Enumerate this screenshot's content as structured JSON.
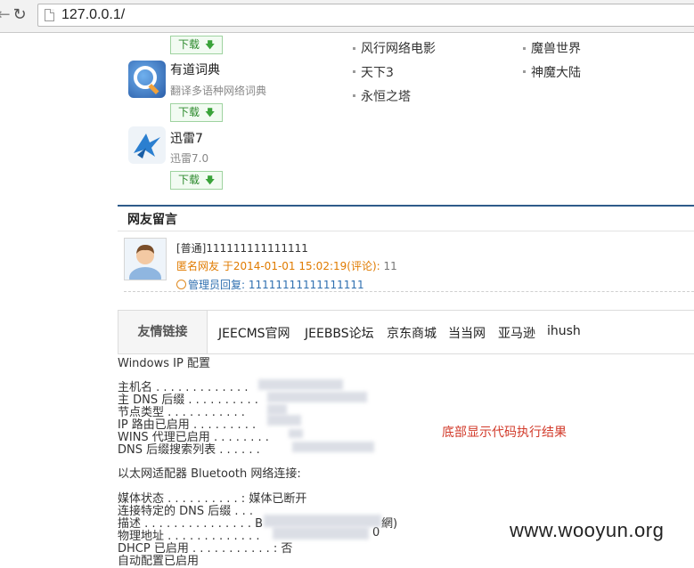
{
  "browser": {
    "url": "127.0.0.1/"
  },
  "downloads": {
    "button_label": "下载",
    "apps": [
      {
        "name": "有道词典",
        "desc": "翻译多语种网络词典",
        "icon": "youdao-dictionary-icon"
      },
      {
        "name": "迅雷7",
        "desc": "迅雷7.0",
        "icon": "thunder-bird-icon"
      }
    ]
  },
  "games": [
    "风行网络电影",
    "天下3",
    "永恒之塔",
    "魔兽世界",
    "神魔大陆"
  ],
  "comments": {
    "title": "网友留言",
    "items": [
      {
        "tag": "[普通]",
        "content": "111111111111111",
        "meta": "匿名网友 于2014-01-01 15:02:19(评论):",
        "count": "11",
        "reply_label": "管理员回复:",
        "reply": "11111111111111111"
      }
    ]
  },
  "friend_links": {
    "title": "友情链接",
    "links": [
      "JEECMS官网",
      "JEEBBS论坛",
      "京东商城",
      "当当网",
      "亚马逊",
      "ihush"
    ]
  },
  "ipconfig": {
    "header": "Windows IP 配置",
    "host_name": "主机名",
    "primary_dns": "主 DNS 后缀",
    "node_type": "节点类型",
    "ip_routing": "IP 路由已启用",
    "wins_proxy": "WINS 代理已启用",
    "dns_search": "DNS 后缀搜索列表",
    "adapter": "以太网适配器 Bluetooth 网络连接:",
    "media_state": "媒体状态",
    "media_state_value": "媒体已断开",
    "conn_dns": "连接特定的 DNS 后缀",
    "description": "描述",
    "description_value_start": "B",
    "description_value_end": "網)",
    "physical_address": "物理地址",
    "physical_address_end": "0",
    "dhcp": "DHCP 已启用",
    "dhcp_value": "否",
    "autoconfig": "自动配置已启用"
  },
  "annotation": "底部显示代码执行结果",
  "watermark": "www.wooyun.org"
}
